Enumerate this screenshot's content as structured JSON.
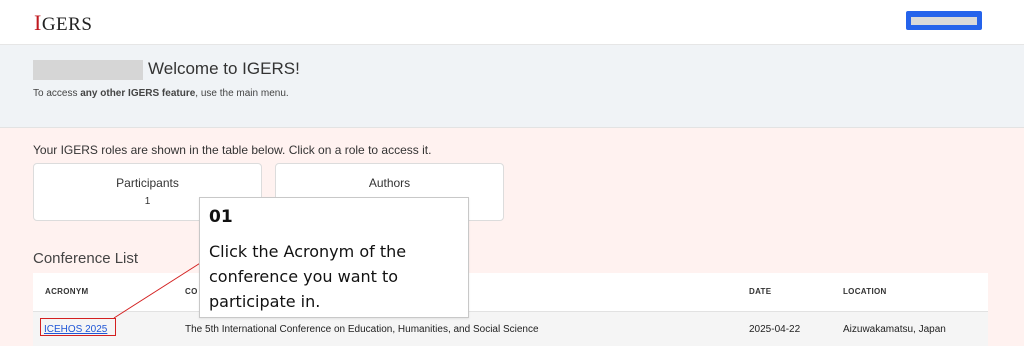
{
  "header": {
    "logo_first": "I",
    "logo_rest": "GERS",
    "accent_color": "#c0181f",
    "button_color": "#2563eb"
  },
  "welcome": {
    "title": "Welcome to IGERS!",
    "note_prefix": "To access ",
    "note_bold": "any other IGERS feature",
    "note_suffix": ", use the main menu."
  },
  "roles": {
    "intro": "Your IGERS roles are shown in the table below. Click on a role to access it.",
    "cards": [
      {
        "title": "Participants",
        "count": "1"
      },
      {
        "title": "Authors",
        "count": ""
      }
    ]
  },
  "conference_list": {
    "title": "Conference List",
    "headers": {
      "acronym": "ACRONYM",
      "conference": "CO",
      "date": "DATE",
      "location": "LOCATION"
    },
    "rows": [
      {
        "acronym": "ICEHOS 2025",
        "conference": "The 5th International Conference on Education, Humanities, and Social Science",
        "date": "2025-04-22",
        "location": "Aizuwakamatsu, Japan"
      }
    ]
  },
  "tooltip": {
    "step": "01",
    "message": "Click the Acronym of the conference you want to participate in.",
    "highlight_color": "#d32020"
  }
}
